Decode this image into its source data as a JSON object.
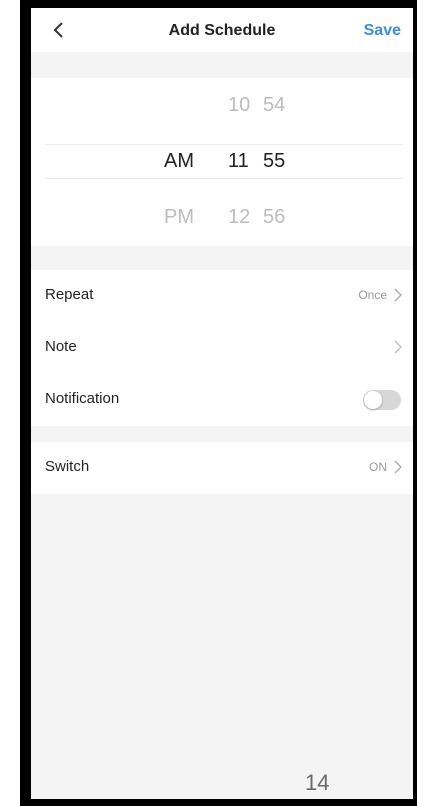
{
  "header": {
    "title": "Add Schedule",
    "save_label": "Save",
    "back_icon": "chevron-left-icon"
  },
  "picker": {
    "rows": [
      {
        "period": "",
        "hour": "10",
        "minute": "54"
      },
      {
        "period": "AM",
        "hour": "11",
        "minute": "55"
      },
      {
        "period": "PM",
        "hour": "12",
        "minute": "56"
      }
    ],
    "selected_index": 1
  },
  "settings": {
    "repeat": {
      "label": "Repeat",
      "value": "Once"
    },
    "note": {
      "label": "Note",
      "value": ""
    },
    "notification": {
      "label": "Notification",
      "enabled": false
    },
    "switch": {
      "label": "Switch",
      "value": "ON"
    }
  },
  "page_number": "14",
  "colors": {
    "accent": "#3a8de6",
    "background": "#f4f4f4",
    "toggle_off": "#d7d7d7"
  }
}
